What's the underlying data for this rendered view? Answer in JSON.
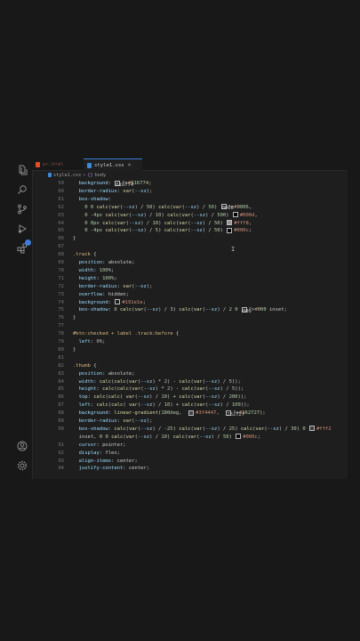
{
  "tabs": [
    {
      "label": "pr.html",
      "color": "#e44d26"
    },
    {
      "label": "style1.css",
      "color": "#3b8ad8",
      "close": "×"
    }
  ],
  "breadcrumb": {
    "file": "style1.css",
    "sep": ">",
    "node": "body",
    "node_icon": "{}"
  },
  "code_lines": [
    {
      "n": "59",
      "t": "  background: #616774;"
    },
    {
      "n": "60",
      "t": "  border-radius: var(--sz);"
    },
    {
      "n": "61",
      "t": "  box-shadow:"
    },
    {
      "n": "62",
      "t": "    0 0 calc(var(--sz) / 50) calc(var(--sz) / 50) #0006,"
    },
    {
      "n": "63",
      "t": "    0 -4px calc(var(--sz) / 10) calc(var(--sz) / 500) #000d,"
    },
    {
      "n": "64",
      "t": "    0 0px calc(var(--sz) / 10) calc(var(--sz) / 50) #fff8,"
    },
    {
      "n": "65",
      "t": "    0 -4px calc(var(--sz) / 5) calc(var(--sz) / 50) #000c;"
    },
    {
      "n": "66",
      "t": "}"
    },
    {
      "n": "67",
      "t": ""
    },
    {
      "n": "68",
      "t": ".track {"
    },
    {
      "n": "69",
      "t": "  position: absolute;"
    },
    {
      "n": "70",
      "t": "  width: 100%;"
    },
    {
      "n": "71",
      "t": "  height: 100%;"
    },
    {
      "n": "72",
      "t": "  border-radius: var(--sz);"
    },
    {
      "n": "73",
      "t": "  overflow: hidden;"
    },
    {
      "n": "74",
      "t": "  background: #191e1e;"
    },
    {
      "n": "75",
      "t": "  box-shadow: 0 calc(var(--sz) / 3) calc(var(--sz) / 2 0 #000 inset;"
    },
    {
      "n": "76",
      "t": "}"
    },
    {
      "n": "77",
      "t": ""
    },
    {
      "n": "78",
      "t": "#btn:checked + label .track:before {"
    },
    {
      "n": "79",
      "t": "  left: 0%;"
    },
    {
      "n": "80",
      "t": "}"
    },
    {
      "n": "81",
      "t": ""
    },
    {
      "n": "82",
      "t": ".thumb {"
    },
    {
      "n": "83",
      "t": "  position: absolute;"
    },
    {
      "n": "84",
      "t": "  width: calc(calc(var(--sz) * 2) - calc(var(--sz) / 5));"
    },
    {
      "n": "85",
      "t": "  height: calc(calc(var(--sz) * 2) - calc(var(--sz) / 5));"
    },
    {
      "n": "86",
      "t": "  top: calc(calc( var(--sz) / 10) + calc(var(--sz) / 200));"
    },
    {
      "n": "87",
      "t": "  left: calc(calc( var(--sz) / 10) + calc(var(--sz) / 100));"
    },
    {
      "n": "88",
      "t": "  background: linear-gradient(180deg,  #3f4447,  #262727);"
    },
    {
      "n": "89",
      "t": "  border-radius: var(--sz);"
    },
    {
      "n": "90",
      "t": "  box-shadow: calc(var(--sz) / -25) calc(var(--sz) / 25) calc(var(--sz) / 30) 0 #fff2"
    },
    {
      "n": "",
      "t": "  inset, 0 0 calc(var(--sz) / 10) calc(var(--sz) / 50) #000c;"
    },
    {
      "n": "91",
      "t": "  cursor: pointer;"
    },
    {
      "n": "92",
      "t": "  display: flex;"
    },
    {
      "n": "93",
      "t": "  align-items: center;"
    },
    {
      "n": "94",
      "t": "  justify-content: center;"
    }
  ],
  "icons": [
    "files-icon",
    "search-icon",
    "source-control-icon",
    "run-debug-icon",
    "extensions-icon",
    "accounts-icon",
    "settings-gear-icon"
  ],
  "colors": {
    "editor_bg": "#1e1e1e",
    "accent": "#3b7dd8",
    "selector": "#d7ba7d",
    "property": "#9cdcfe",
    "value": "#ce9178"
  }
}
